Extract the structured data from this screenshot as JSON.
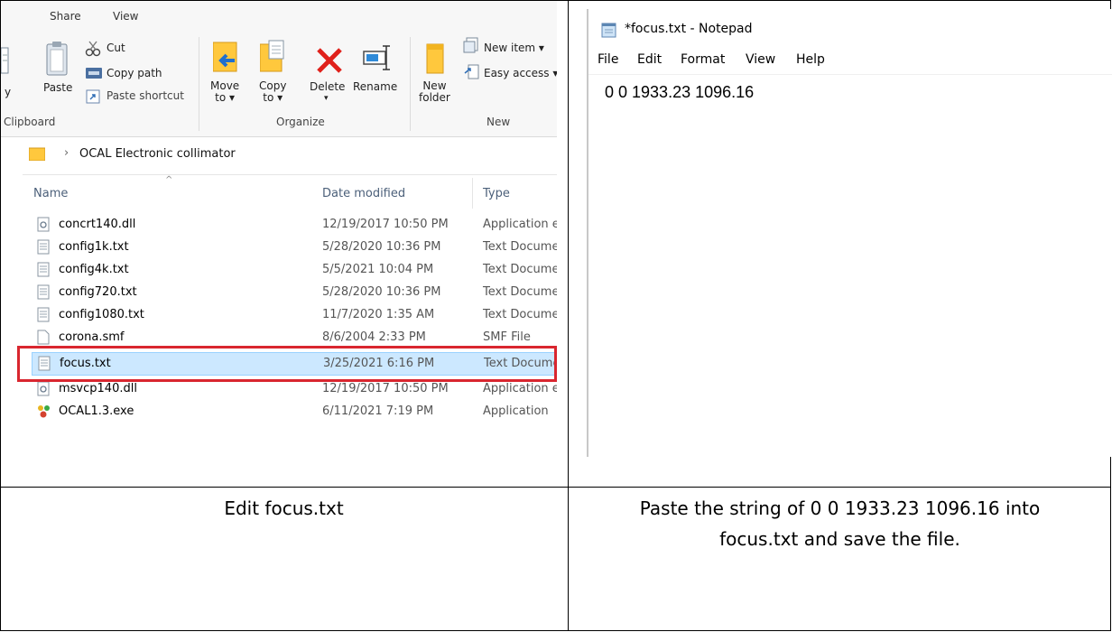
{
  "explorer": {
    "tabs": [
      "Share",
      "View"
    ],
    "ribbon": {
      "clipboard": {
        "copy_fragment": "y",
        "paste": "Paste",
        "cut": "Cut",
        "copy_path": "Copy path",
        "paste_shortcut": "Paste shortcut",
        "group_label": "Clipboard"
      },
      "organize": {
        "move_to": [
          "Move",
          "to ▾"
        ],
        "copy_to": [
          "Copy",
          "to ▾"
        ],
        "delete": "Delete",
        "delete_arrow": "▾",
        "rename": "Rename",
        "group_label": "Organize"
      },
      "new": {
        "new_folder": [
          "New",
          "folder"
        ],
        "new_item": "New item ▾",
        "easy_access": "Easy access ▾",
        "group_label": "New"
      }
    },
    "address": {
      "chevron": "›",
      "path": "OCAL Electronic collimator"
    },
    "columns": {
      "name": "Name",
      "date_modified": "Date modified",
      "type": "Type",
      "sort_indicator": "^"
    },
    "files": [
      {
        "name": "concrt140.dll",
        "date": "12/19/2017 10:50 PM",
        "type": "Application e",
        "icon": "dll-icon"
      },
      {
        "name": "config1k.txt",
        "date": "5/28/2020 10:36 PM",
        "type": "Text Docume",
        "icon": "text-file-icon"
      },
      {
        "name": "config4k.txt",
        "date": "5/5/2021 10:04 PM",
        "type": "Text Docume",
        "icon": "text-file-icon"
      },
      {
        "name": "config720.txt",
        "date": "5/28/2020 10:36 PM",
        "type": "Text Docume",
        "icon": "text-file-icon"
      },
      {
        "name": "config1080.txt",
        "date": "11/7/2020 1:35 AM",
        "type": "Text Docume",
        "icon": "text-file-icon"
      },
      {
        "name": "corona.smf",
        "date": "8/6/2004 2:33 PM",
        "type": "SMF File",
        "icon": "blank-file-icon"
      },
      {
        "name": "focus.txt",
        "date": "3/25/2021 6:16 PM",
        "type": "Text Docume",
        "icon": "text-file-icon",
        "selected": true
      },
      {
        "name": "msvcp140.dll",
        "date": "12/19/2017 10:50 PM",
        "type": "Application e",
        "icon": "dll-icon"
      },
      {
        "name": "OCAL1.3.exe",
        "date": "6/11/2021 7:19 PM",
        "type": "Application",
        "icon": "exe-icon"
      }
    ],
    "highlight_color": "#d9262f",
    "selection_color": "#cce8ff"
  },
  "notepad": {
    "title": "*focus.txt - Notepad",
    "menu": [
      "File",
      "Edit",
      "Format",
      "View",
      "Help"
    ],
    "content": "0 0 1933.23 1096.16"
  },
  "captions": {
    "left": "Edit focus.txt",
    "right": [
      "Paste the string of 0 0 1933.23 1096.16 into",
      "focus.txt and save the file."
    ]
  }
}
